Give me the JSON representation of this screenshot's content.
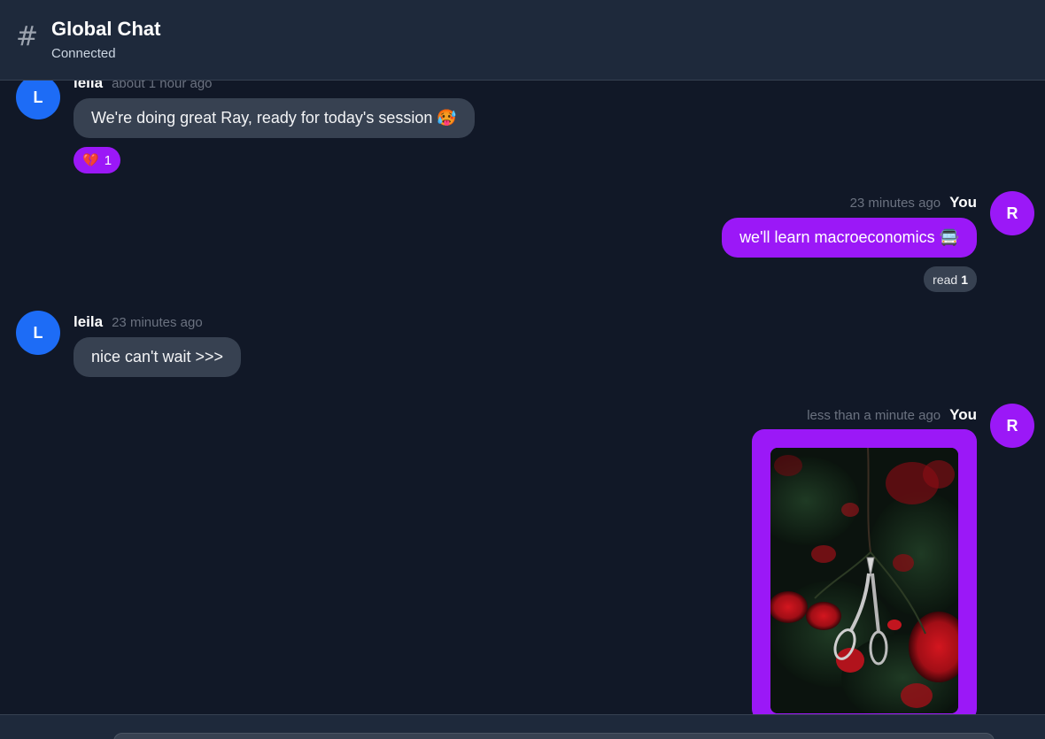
{
  "header": {
    "icon": "hash-icon",
    "title": "Global Chat",
    "status": "Connected"
  },
  "messages": [
    {
      "author": "leila",
      "avatar_letter": "L",
      "time": "about 1 hour ago",
      "text": "We're doing great Ray, ready for today's session 🥵",
      "reaction": {
        "emoji": "💔",
        "count": "1"
      }
    },
    {
      "author": "You",
      "avatar_letter": "R",
      "time": "23 minutes ago",
      "text": "we'll learn macroeconomics 🚍",
      "read": {
        "label": "read",
        "count": "1"
      }
    },
    {
      "author": "leila",
      "avatar_letter": "L",
      "time": "23 minutes ago",
      "text": "nice can't wait >>>"
    },
    {
      "author": "You",
      "avatar_letter": "R",
      "time": "less than a minute ago",
      "attachment": "image of silver scissors hanging among red roses"
    }
  ],
  "colors": {
    "accent": "#9b18f7",
    "avatar_other": "#1d6cf6",
    "bubble_other": "#374151",
    "background": "#111827",
    "header": "#1e293b"
  }
}
